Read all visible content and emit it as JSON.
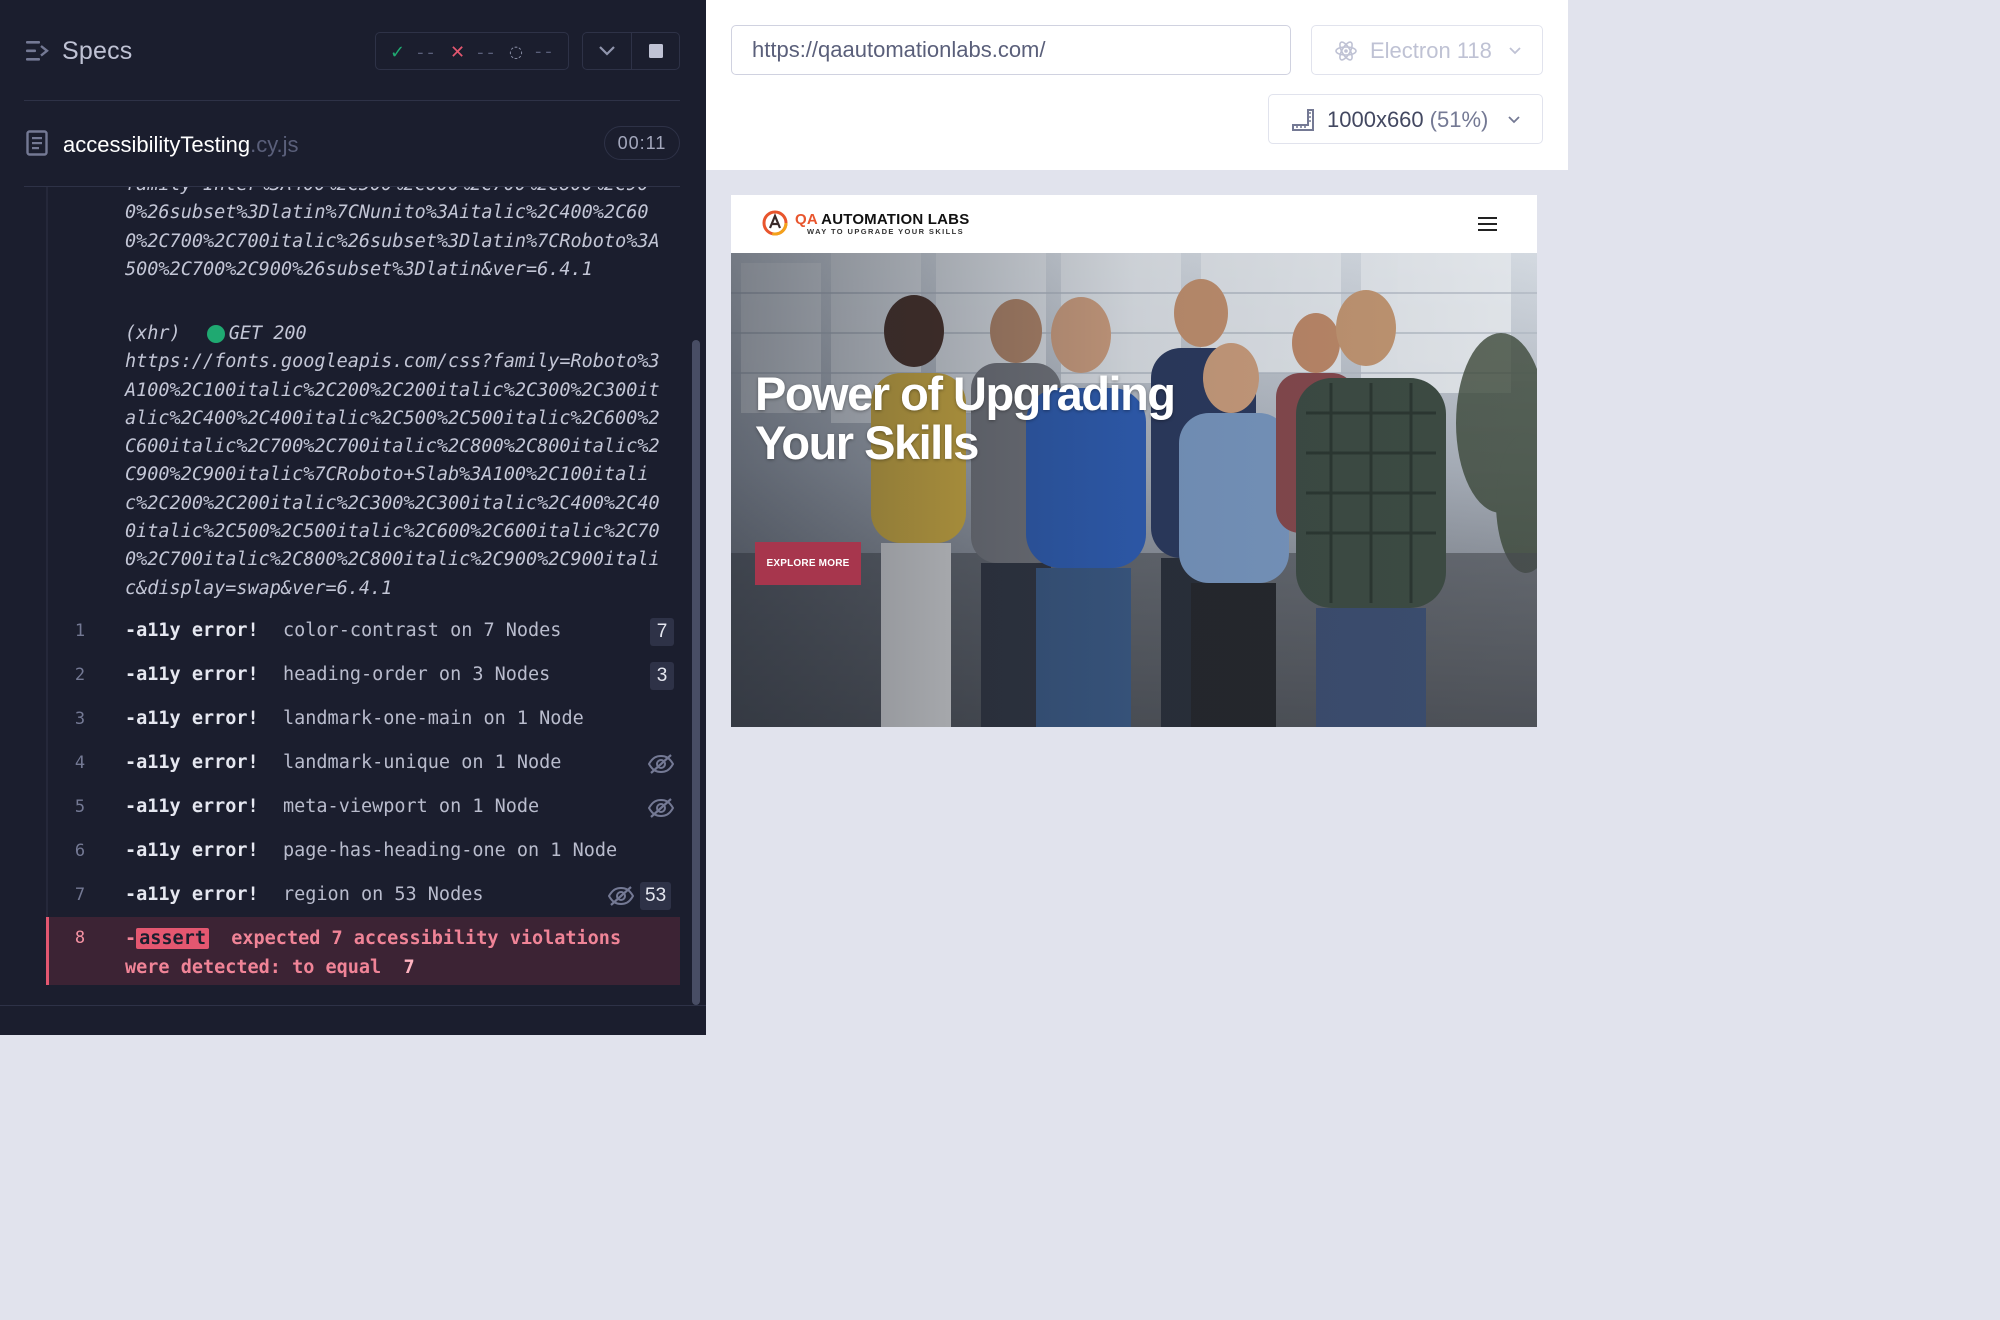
{
  "reporter": {
    "specs_label": "Specs",
    "stats": {
      "passed": "--",
      "failed": "--",
      "pending": "--"
    },
    "spec_file": {
      "name": "accessibilityTesting",
      "ext": ".cy.js"
    },
    "duration": "00:11",
    "xhr_tail": "family=Inter%3A400%2C500%2C600%2C700%2C800%2C900%26subset%3Dlatin%7CNunito%3Aitalic%2C400%2C600%2C700%2C700italic%26subset%3Dlatin%7CRoboto%3A500%2C700%2C900%26subset%3Dlatin&ver=6.4.1",
    "xhr": {
      "label": "(xhr)",
      "status": "GET 200",
      "url": "https://fonts.googleapis.com/css?family=Roboto%3A100%2C100italic%2C200%2C200italic%2C300%2C300italic%2C400%2C400italic%2C500%2C500italic%2C600%2C600italic%2C700%2C700italic%2C800%2C800italic%2C900%2C900italic%7CRoboto+Slab%3A100%2C100italic%2C200%2C200italic%2C300%2C300italic%2C400%2C400italic%2C500%2C500italic%2C600%2C600italic%2C700%2C700italic%2C800%2C800italic%2C900%2C900italic&display=swap&ver=6.4.1"
    },
    "commands": [
      {
        "num": "1",
        "name": "-a11y error!",
        "message": "color-contrast on 7 Nodes",
        "badge": "7",
        "hidden": false
      },
      {
        "num": "2",
        "name": "-a11y error!",
        "message": "heading-order on 3 Nodes",
        "badge": "3",
        "hidden": false
      },
      {
        "num": "3",
        "name": "-a11y error!",
        "message": "landmark-one-main on 1 Node",
        "badge": "",
        "hidden": false
      },
      {
        "num": "4",
        "name": "-a11y error!",
        "message": "landmark-unique on 1 Node",
        "badge": "",
        "hidden": true
      },
      {
        "num": "5",
        "name": "-a11y error!",
        "message": "meta-viewport on 1 Node",
        "badge": "",
        "hidden": true
      },
      {
        "num": "6",
        "name": "-a11y error!",
        "message": "page-has-heading-one on 1 Node",
        "badge": "",
        "hidden": false
      },
      {
        "num": "7",
        "name": "-a11y error!",
        "message": "region on 53 Nodes",
        "badge": "53",
        "hidden": true
      }
    ],
    "assert": {
      "num": "8",
      "dash": "-",
      "tag": "assert",
      "message_a": "expected 7 accessibility violations were detected: to equal",
      "value": "7"
    }
  },
  "aut": {
    "url": "https://qaautomationlabs.com/",
    "browser": "Electron 118",
    "viewport": "1000x660",
    "scale": "(51%)"
  },
  "site": {
    "logo_qa": "QA",
    "logo_title": "AUTOMATION LABS",
    "logo_tagline": "WAY TO UPGRADE YOUR SKILLS",
    "hero_title": "Power of Upgrading Your Skills",
    "hero_button": "EXPLORE MORE"
  },
  "colors": {
    "reporter_bg": "#1b1e2e",
    "pass": "#1fa971",
    "fail": "#e45770",
    "accent_button": "#a7364d",
    "logo_orange": "#e8552d"
  },
  "icons": [
    "specs-list-icon",
    "check-icon",
    "x-icon",
    "pending-icon",
    "chevron-down-icon",
    "stop-icon",
    "document-icon",
    "eye-off-icon",
    "electron-icon",
    "ruler-icon",
    "hamburger-icon"
  ]
}
